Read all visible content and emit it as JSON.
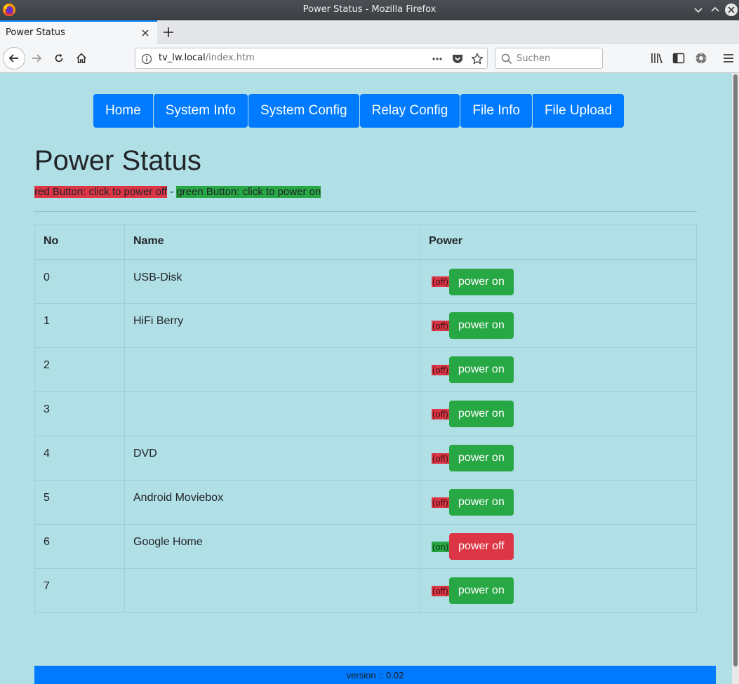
{
  "window": {
    "title": "Power Status - Mozilla Firefox"
  },
  "tabs": [
    {
      "label": "Power Status",
      "active": true
    }
  ],
  "navbar": {
    "url_host": "tv_lw.local",
    "url_path": "/index.htm",
    "search_placeholder": "Suchen"
  },
  "page": {
    "menu": [
      "Home",
      "System Info",
      "System Config",
      "Relay Config",
      "File Info",
      "File Upload"
    ],
    "title": "Power Status",
    "legend": {
      "red": "red Button: click to power off",
      "separator": " - ",
      "green": "green Button: click to power on"
    },
    "table": {
      "headers": [
        "No",
        "Name",
        "Power"
      ],
      "rows": [
        {
          "no": "0",
          "name": "USB-Disk",
          "state": "(off)",
          "action": "power on"
        },
        {
          "no": "1",
          "name": "HiFi Berry",
          "state": "(off)",
          "action": "power on"
        },
        {
          "no": "2",
          "name": "",
          "state": "(off)",
          "action": "power on"
        },
        {
          "no": "3",
          "name": "",
          "state": "(off)",
          "action": "power on"
        },
        {
          "no": "4",
          "name": "DVD",
          "state": "(off)",
          "action": "power on"
        },
        {
          "no": "5",
          "name": "Android Moviebox",
          "state": "(off)",
          "action": "power on"
        },
        {
          "no": "6",
          "name": "Google Home",
          "state": "(on)",
          "action": "power off"
        },
        {
          "no": "7",
          "name": "",
          "state": "(off)",
          "action": "power on"
        }
      ]
    },
    "footer": "version :: 0.02"
  },
  "colors": {
    "page_background": "#b0dfe5",
    "menu_blue": "#007bff",
    "power_on_green": "#28a745",
    "power_off_red": "#dc3545"
  },
  "icons": {
    "titlebar": [
      "firefox-logo-icon",
      "minimize-icon",
      "maximize-icon",
      "close-window-icon"
    ],
    "navbar": [
      "back-icon",
      "forward-icon",
      "reload-icon",
      "home-icon",
      "info-icon",
      "page-actions-icon",
      "pocket-icon",
      "bookmark-star-icon",
      "search-icon",
      "library-icon",
      "sidebar-icon",
      "extension-icon",
      "hamburger-menu-icon"
    ]
  }
}
